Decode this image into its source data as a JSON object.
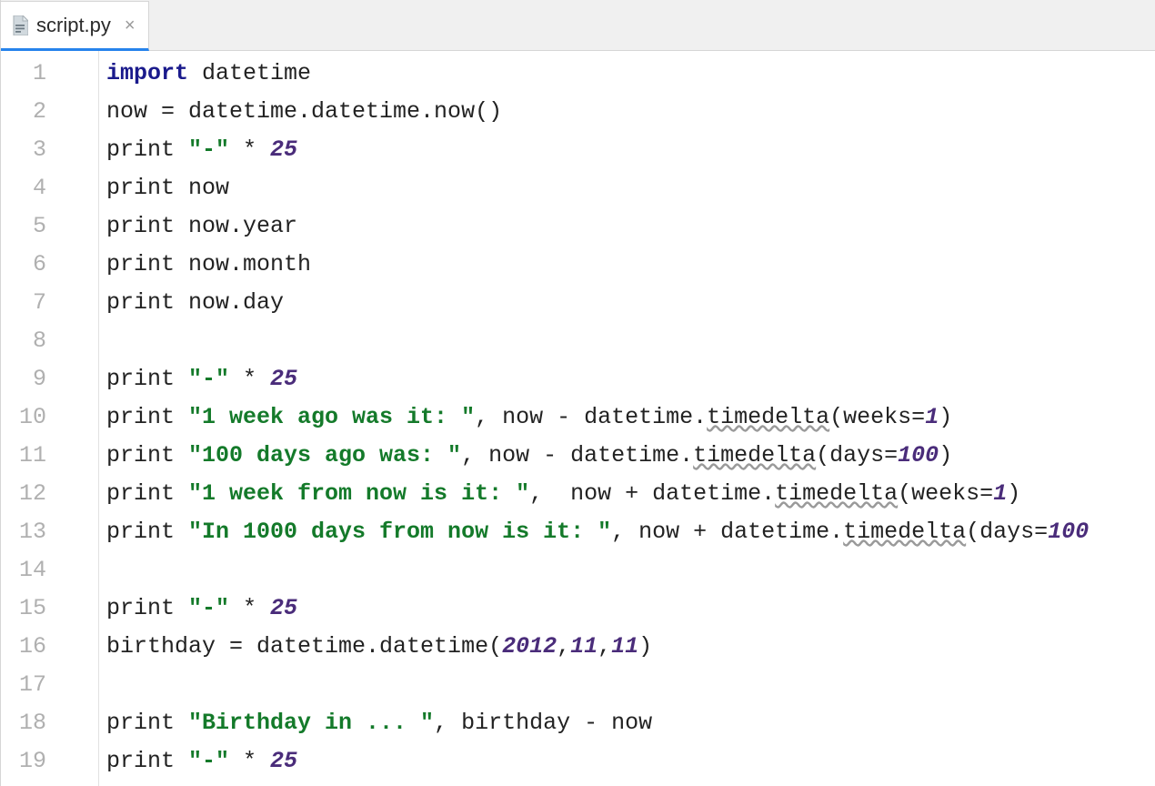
{
  "tab": {
    "filename": "script.py",
    "close_glyph": "×"
  },
  "gutter": [
    "1",
    "2",
    "3",
    "4",
    "5",
    "6",
    "7",
    "8",
    "9",
    "10",
    "11",
    "12",
    "13",
    "14",
    "15",
    "16",
    "17",
    "18",
    "19"
  ],
  "code": [
    {
      "tokens": [
        {
          "t": "import",
          "c": "kw"
        },
        {
          "t": " datetime"
        }
      ]
    },
    {
      "tokens": [
        {
          "t": "now = datetime.datetime.now()"
        }
      ]
    },
    {
      "tokens": [
        {
          "t": "print "
        },
        {
          "t": "\"-\"",
          "c": "str"
        },
        {
          "t": " * "
        },
        {
          "t": "25",
          "c": "num"
        }
      ]
    },
    {
      "tokens": [
        {
          "t": "print now"
        }
      ]
    },
    {
      "tokens": [
        {
          "t": "print now.year"
        }
      ]
    },
    {
      "tokens": [
        {
          "t": "print now.month"
        }
      ]
    },
    {
      "tokens": [
        {
          "t": "print now.day"
        }
      ]
    },
    {
      "tokens": []
    },
    {
      "tokens": [
        {
          "t": "print "
        },
        {
          "t": "\"-\"",
          "c": "str"
        },
        {
          "t": " * "
        },
        {
          "t": "25",
          "c": "num"
        }
      ]
    },
    {
      "tokens": [
        {
          "t": "print "
        },
        {
          "t": "\"1 week ago was it: \"",
          "c": "str"
        },
        {
          "t": ", now - datetime."
        },
        {
          "t": "timedelta",
          "c": "warn"
        },
        {
          "t": "(weeks="
        },
        {
          "t": "1",
          "c": "numarg"
        },
        {
          "t": ")"
        }
      ]
    },
    {
      "tokens": [
        {
          "t": "print "
        },
        {
          "t": "\"100 days ago was: \"",
          "c": "str"
        },
        {
          "t": ", now - datetime."
        },
        {
          "t": "timedelta",
          "c": "warn"
        },
        {
          "t": "(days="
        },
        {
          "t": "100",
          "c": "numarg"
        },
        {
          "t": ")"
        }
      ]
    },
    {
      "tokens": [
        {
          "t": "print "
        },
        {
          "t": "\"1 week from now is it: \"",
          "c": "str"
        },
        {
          "t": ",  now + datetime."
        },
        {
          "t": "timedelta",
          "c": "warn"
        },
        {
          "t": "(weeks="
        },
        {
          "t": "1",
          "c": "numarg"
        },
        {
          "t": ")"
        }
      ]
    },
    {
      "tokens": [
        {
          "t": "print "
        },
        {
          "t": "\"In 1000 days from now is it: \"",
          "c": "str"
        },
        {
          "t": ", now + datetime."
        },
        {
          "t": "timedelta",
          "c": "warn"
        },
        {
          "t": "(days="
        },
        {
          "t": "100",
          "c": "numarg"
        }
      ]
    },
    {
      "tokens": []
    },
    {
      "tokens": [
        {
          "t": "print "
        },
        {
          "t": "\"-\"",
          "c": "str"
        },
        {
          "t": " * "
        },
        {
          "t": "25",
          "c": "num"
        }
      ]
    },
    {
      "tokens": [
        {
          "t": "birthday = datetime.datetime("
        },
        {
          "t": "2012",
          "c": "numarg"
        },
        {
          "t": ","
        },
        {
          "t": "11",
          "c": "numarg"
        },
        {
          "t": ","
        },
        {
          "t": "11",
          "c": "numarg"
        },
        {
          "t": ")"
        }
      ]
    },
    {
      "tokens": []
    },
    {
      "tokens": [
        {
          "t": "print "
        },
        {
          "t": "\"Birthday in ... \"",
          "c": "str"
        },
        {
          "t": ", birthday - now"
        }
      ]
    },
    {
      "tokens": [
        {
          "t": "print "
        },
        {
          "t": "\"-\"",
          "c": "str"
        },
        {
          "t": " * "
        },
        {
          "t": "25",
          "c": "num"
        }
      ]
    }
  ]
}
